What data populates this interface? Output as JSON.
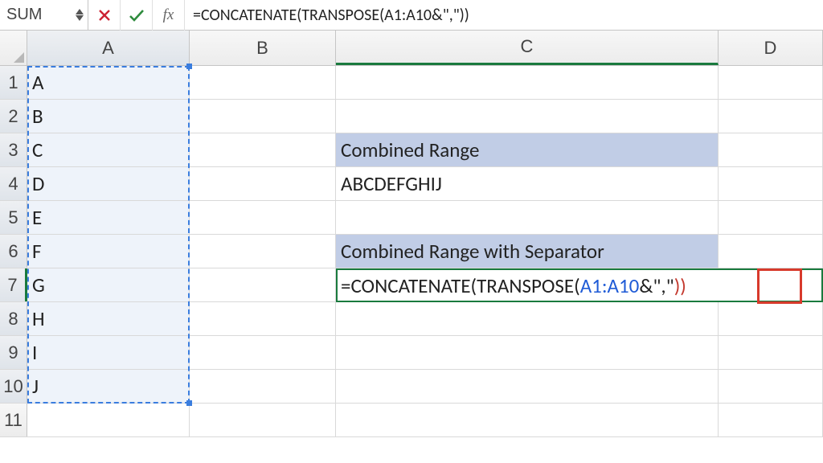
{
  "formula_bar": {
    "name_box": "SUM",
    "fx_label": "fx",
    "formula": "=CONCATENATE(TRANSPOSE(A1:A10&\",\"))"
  },
  "columns": [
    "A",
    "B",
    "C",
    "D"
  ],
  "cells": {
    "A1": "A",
    "A2": "B",
    "A3": "C",
    "A4": "D",
    "A5": "E",
    "A6": "F",
    "A7": "G",
    "A8": "H",
    "A9": "I",
    "A10": "J",
    "C3": "Combined Range",
    "C4": "ABCDEFGHIJ",
    "C6": "Combined Range with Separator"
  },
  "editing": {
    "prefix": "=CONCATENATE(TRANSPOSE(",
    "ref": "A1:A10",
    "mid": "&\",\"",
    "close": "))"
  },
  "row_count": 11,
  "colors": {
    "marquee": "#3a7dde",
    "active": "#1a7a3e",
    "hdrfill": "#c1cde6",
    "annot": "#d83a2c"
  },
  "chart_data": {
    "type": "table",
    "columns": [
      "A"
    ],
    "rows": [
      [
        "A"
      ],
      [
        "B"
      ],
      [
        "C"
      ],
      [
        "D"
      ],
      [
        "E"
      ],
      [
        "F"
      ],
      [
        "G"
      ],
      [
        "H"
      ],
      [
        "I"
      ],
      [
        "J"
      ]
    ]
  }
}
